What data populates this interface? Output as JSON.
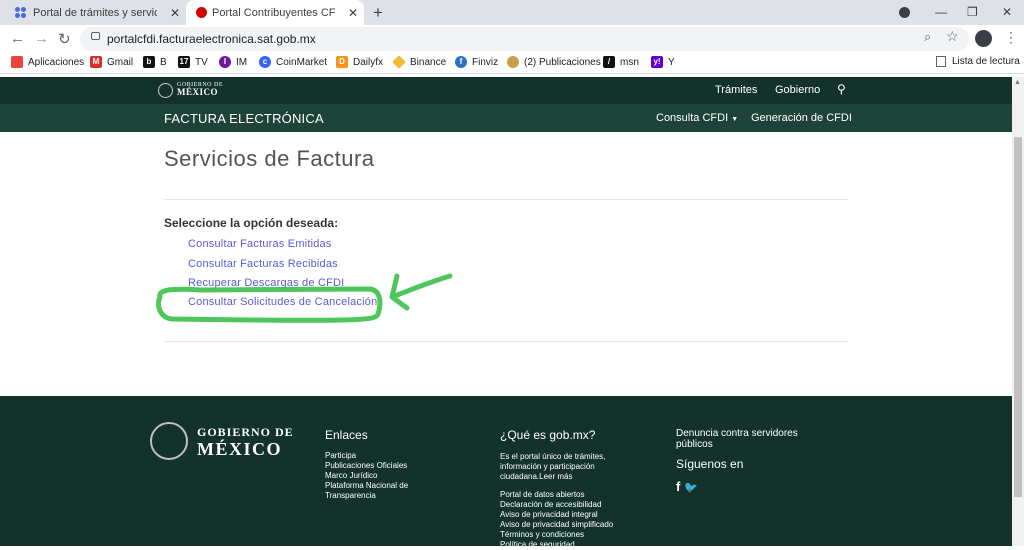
{
  "browser": {
    "tabs": [
      {
        "title": "Portal de trámites y servicios - SAT"
      },
      {
        "title": "Portal Contribuyentes CFDI | Búsqueda"
      }
    ],
    "url": "portalcfdi.facturaelectronica.sat.gob.mx",
    "bookmarks": [
      {
        "label": "Aplicaciones",
        "icon": "apps-grid-icon",
        "color": "#e8453c"
      },
      {
        "label": "Gmail",
        "icon": "gmail-icon",
        "color": "#d93025"
      },
      {
        "label": "B",
        "icon": "b-icon",
        "color": "#111111"
      },
      {
        "label": "TV",
        "icon": "tv-icon",
        "color": "#111111"
      },
      {
        "label": "IM",
        "icon": "im-icon",
        "color": "#6a1b9a"
      },
      {
        "label": "CoinMarket",
        "icon": "coinmarket-icon",
        "color": "#3861fb"
      },
      {
        "label": "Dailyfx",
        "icon": "dailyfx-icon",
        "color": "#f7931a"
      },
      {
        "label": "Binance",
        "icon": "binance-icon",
        "color": "#f3ba2f"
      },
      {
        "label": "Finviz",
        "icon": "finviz-icon",
        "color": "#2a72c4"
      },
      {
        "label": "(2) Publicaciones",
        "icon": "publicaciones-icon",
        "color": "#c8a04a"
      },
      {
        "label": "msn",
        "icon": "msn-icon",
        "color": "#111111"
      },
      {
        "label": "Y",
        "icon": "yahoo-icon",
        "color": "#6001d2"
      }
    ],
    "reading_list": "Lista de lectura"
  },
  "header": {
    "logo_line1": "GOBIERNO DE",
    "logo_line2": "MÉXICO",
    "nav": [
      "Trámites",
      "Gobierno"
    ],
    "site_title": "FACTURA ELECTRÓNICA",
    "subnav": [
      "Consulta CFDI",
      "Generación de CFDI"
    ]
  },
  "main": {
    "title": "Servicios de Factura",
    "prompt": "Seleccione la opción deseada:",
    "options": [
      "Consultar Facturas Emitidas",
      "Consultar Facturas Recibidas",
      "Recuperar Descargas de CFDI",
      "Consultar Solicitudes de Cancelación"
    ]
  },
  "footer": {
    "logo_line1": "GOBIERNO DE",
    "logo_line2": "MÉXICO",
    "col1": {
      "heading": "Enlaces",
      "links": [
        "Participa",
        "Publicaciones Oficiales",
        "Marco Jurídico",
        "Plataforma Nacional de",
        "Transparencia"
      ]
    },
    "col2": {
      "heading": "¿Qué es gob.mx?",
      "text": [
        "Es el portal único de trámites,",
        "información y participación",
        "ciudadana.Leer más"
      ],
      "links": [
        "Portal de datos abiertos",
        "Declaración de accesibilidad",
        "Aviso de privacidad integral",
        "Aviso de privacidad simplificado",
        "Términos y condiciones",
        "Política de seguridad"
      ]
    },
    "col3": {
      "denuncia": [
        "Denuncia contra servidores",
        "públicos"
      ],
      "follow": "Síguenos en"
    }
  },
  "colors": {
    "gob_dark": "#13322b",
    "gob_sub": "#1e4339",
    "link": "#5b5bd6",
    "annotation": "#3cc04a"
  }
}
